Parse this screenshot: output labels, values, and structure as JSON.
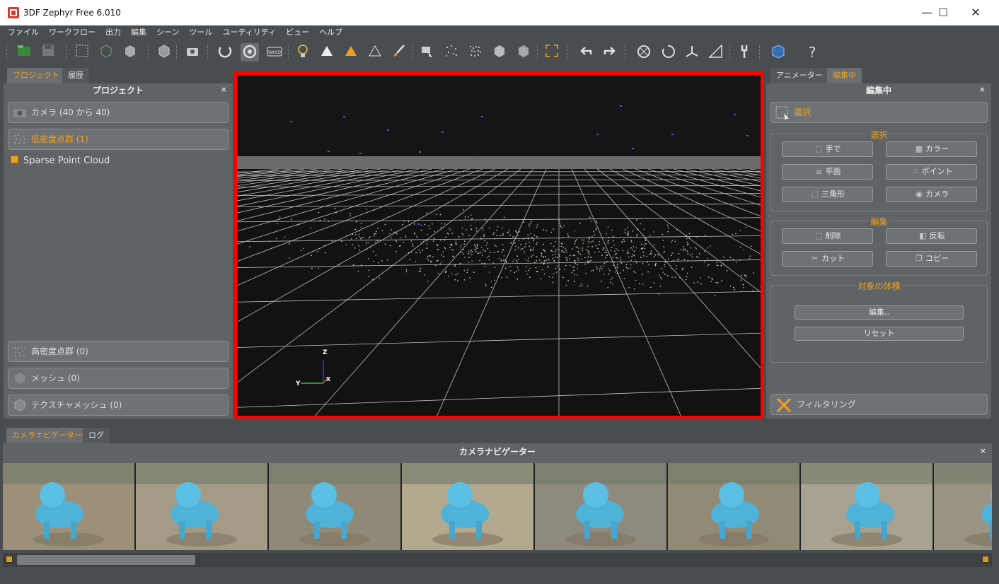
{
  "window": {
    "title": "3DF Zephyr Free 6.010",
    "minimize": "—",
    "maximize": "☐",
    "close": "✕"
  },
  "menu": [
    "ファイル",
    "ワークフロー",
    "出力",
    "編集",
    "シーン",
    "ツール",
    "ユーティリティ",
    "ビュー",
    "ヘルプ"
  ],
  "left": {
    "tabs": [
      "プロジェクト",
      "履歴"
    ],
    "header": "プロジェクト",
    "close": "×",
    "cameras": "カメラ (40 から 40)",
    "sparse": "低密度点群 (1)",
    "tree_item": "Sparse Point Cloud",
    "dense": "高密度点群 (0)",
    "mesh": "メッシュ (0)",
    "textured": "テクスチャメッシュ (0)"
  },
  "right": {
    "tabs": [
      "アニメーター",
      "編集中"
    ],
    "header": "編集中",
    "close": "×",
    "select_button": "選択",
    "select_group": {
      "label": "選択",
      "buttons": [
        "手で",
        "カラー",
        "平面",
        "ポイント",
        "三角形",
        "カメラ"
      ]
    },
    "edit_group": {
      "label": "編集",
      "buttons": [
        "削除",
        "反転",
        "カット",
        "コピー"
      ]
    },
    "volume_group": {
      "label": "対象の体積",
      "edit": "編集..",
      "reset": "リセット"
    },
    "filtering": "フィルタリング"
  },
  "bottom": {
    "tabs": [
      "カメラナビゲーター",
      "ログ"
    ],
    "header": "カメラナビゲーター",
    "close": "×"
  },
  "axes": {
    "z": "Z",
    "y": "Y",
    "x": "X"
  }
}
